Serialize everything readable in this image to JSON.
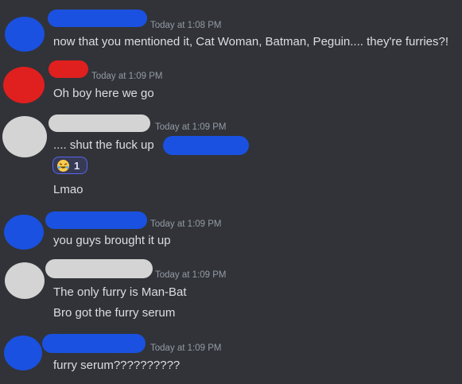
{
  "messages": [
    {
      "timestamp": "Today at 1:08 PM",
      "lines": [
        "now that you mentioned it, Cat Woman, Batman, Peguin.... they're furries?!"
      ],
      "avatar_color": "#1a51e0",
      "name_color": "#1a51e0"
    },
    {
      "timestamp": "Today at 1:09 PM",
      "lines": [
        "Oh boy here we go"
      ],
      "avatar_color": "#e01f1f",
      "name_color": "#e01f1f"
    },
    {
      "timestamp": "Today at 1:09 PM",
      "lines": [
        ".... shut the fuck up",
        "Lmao"
      ],
      "avatar_color": "#d4d4d4",
      "name_color": "#d4d4d4",
      "reaction": {
        "emoji": "rofl-emoji",
        "count": "1"
      }
    },
    {
      "timestamp": "Today at 1:09 PM",
      "lines": [
        "you guys brought it up"
      ],
      "avatar_color": "#1a51e0",
      "name_color": "#1a51e0"
    },
    {
      "timestamp": "Today at 1:09 PM",
      "lines": [
        "The only furry is Man-Bat",
        "Bro got the furry serum"
      ],
      "avatar_color": "#d4d4d4",
      "name_color": "#d4d4d4"
    },
    {
      "timestamp": "Today at 1:09 PM",
      "lines": [
        "furry serum??????????"
      ],
      "avatar_color": "#1a51e0",
      "name_color": "#1a51e0"
    }
  ],
  "colors": {
    "background": "#313338",
    "text": "#dbdee1",
    "timestamp": "#949ba4",
    "redaction_blue": "#1a51e0",
    "reaction_border": "#5865f2"
  }
}
